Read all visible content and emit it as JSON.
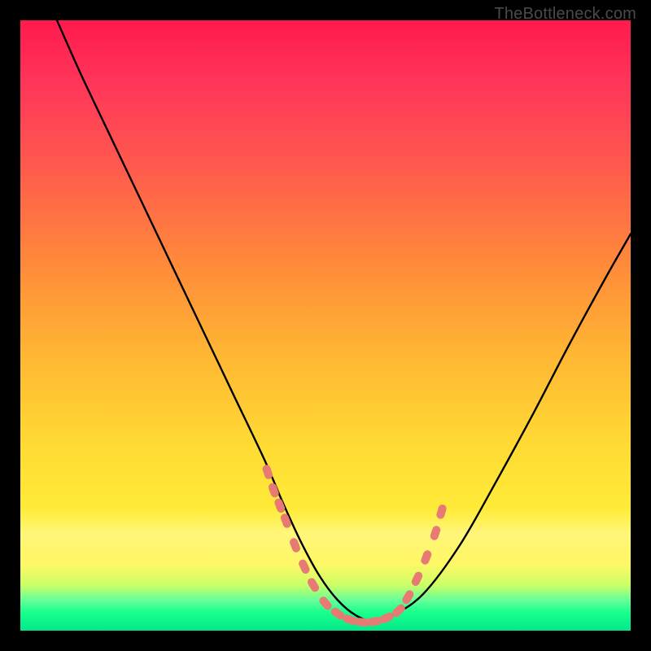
{
  "watermark": "TheBottleneck.com",
  "chart_data": {
    "type": "line",
    "title": "",
    "xlabel": "",
    "ylabel": "",
    "xlim": [
      0,
      100
    ],
    "ylim": [
      0,
      100
    ],
    "grid": false,
    "series": [
      {
        "name": "bottleneck-curve",
        "x": [
          6,
          10,
          15,
          20,
          25,
          30,
          35,
          40,
          43,
          46,
          49,
          52,
          55,
          58,
          61,
          66,
          72,
          78,
          84,
          90,
          96,
          100
        ],
        "y": [
          100,
          91,
          80.5,
          70,
          59.5,
          49,
          38.5,
          28,
          21,
          14.5,
          9,
          5,
          2.5,
          1.5,
          2.5,
          6,
          14,
          24.5,
          35.5,
          47,
          58,
          65
        ]
      }
    ],
    "markers": {
      "shape": "salmon-dash",
      "points_xy": [
        [
          40.5,
          26
        ],
        [
          41.5,
          23
        ],
        [
          42.5,
          20.5
        ],
        [
          43.5,
          18
        ],
        [
          45,
          14
        ],
        [
          46.5,
          10.5
        ],
        [
          48,
          7.5
        ],
        [
          50,
          4.5
        ],
        [
          52,
          2.8
        ],
        [
          54,
          1.8
        ],
        [
          56,
          1.4
        ],
        [
          58,
          1.5
        ],
        [
          60,
          2.1
        ],
        [
          62,
          3.3
        ],
        [
          63.5,
          5.5
        ],
        [
          65,
          8.5
        ],
        [
          66.5,
          12
        ],
        [
          68,
          16
        ],
        [
          69,
          19.5
        ]
      ]
    },
    "background_gradient_stops": [
      {
        "pos": 0.0,
        "color": "#ff1a4d"
      },
      {
        "pos": 0.4,
        "color": "#ff8a3a"
      },
      {
        "pos": 0.75,
        "color": "#ffe233"
      },
      {
        "pos": 0.92,
        "color": "#ccff66"
      },
      {
        "pos": 1.0,
        "color": "#00e88a"
      }
    ]
  }
}
